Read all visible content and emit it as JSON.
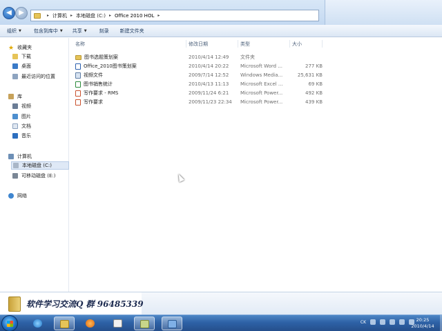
{
  "address_bar": {
    "breadcrumbs": [
      "计算机",
      "本地磁盘 (C:)",
      "Office 2010 HOL"
    ]
  },
  "toolbar": {
    "organize": "组织",
    "include_in_library": "包含到库中",
    "share": "共享",
    "burn": "刻录",
    "new_folder": "新建文件夹"
  },
  "sidebar": {
    "favorites": "收藏夹",
    "downloads": "下载",
    "desktop": "桌面",
    "recent": "最近访问的位置",
    "libraries": "库",
    "videos": "视频",
    "pictures": "图片",
    "documents": "文档",
    "music": "音乐",
    "computer": "计算机",
    "local_disk": "本地磁盘 (C:)",
    "removable_disk": "可移动磁盘 (E:)",
    "network": "网络"
  },
  "columns": {
    "name": "名称",
    "date": "修改日期",
    "type": "类型",
    "size": "大小"
  },
  "files": [
    {
      "name": "图书选题策划案",
      "date": "2010/4/14 12:49",
      "type": "文件夹",
      "size": "",
      "icon": "folder"
    },
    {
      "name": "Office_2010图书策划案",
      "date": "2010/4/14 20:22",
      "type": "Microsoft Word ...",
      "size": "277 KB",
      "icon": "word"
    },
    {
      "name": "视频文件",
      "date": "2009/7/14 12:52",
      "type": "Windows Media...",
      "size": "25,631 KB",
      "icon": "media"
    },
    {
      "name": "图书销售统计",
      "date": "2010/4/13 11:13",
      "type": "Microsoft Excel ...",
      "size": "69 KB",
      "icon": "excel"
    },
    {
      "name": "写作要求 - RMS",
      "date": "2009/11/24 6:21",
      "type": "Microsoft Power...",
      "size": "492 KB",
      "icon": "powerpoint"
    },
    {
      "name": "写作要求",
      "date": "2009/11/23 22:34",
      "type": "Microsoft Power...",
      "size": "439 KB",
      "icon": "powerpoint"
    }
  ],
  "watermark": {
    "text": "软件学习交流Q 群 96485339"
  },
  "taskbar": {
    "lang": "CK",
    "time": "20:25",
    "date": "2010/4/14"
  }
}
